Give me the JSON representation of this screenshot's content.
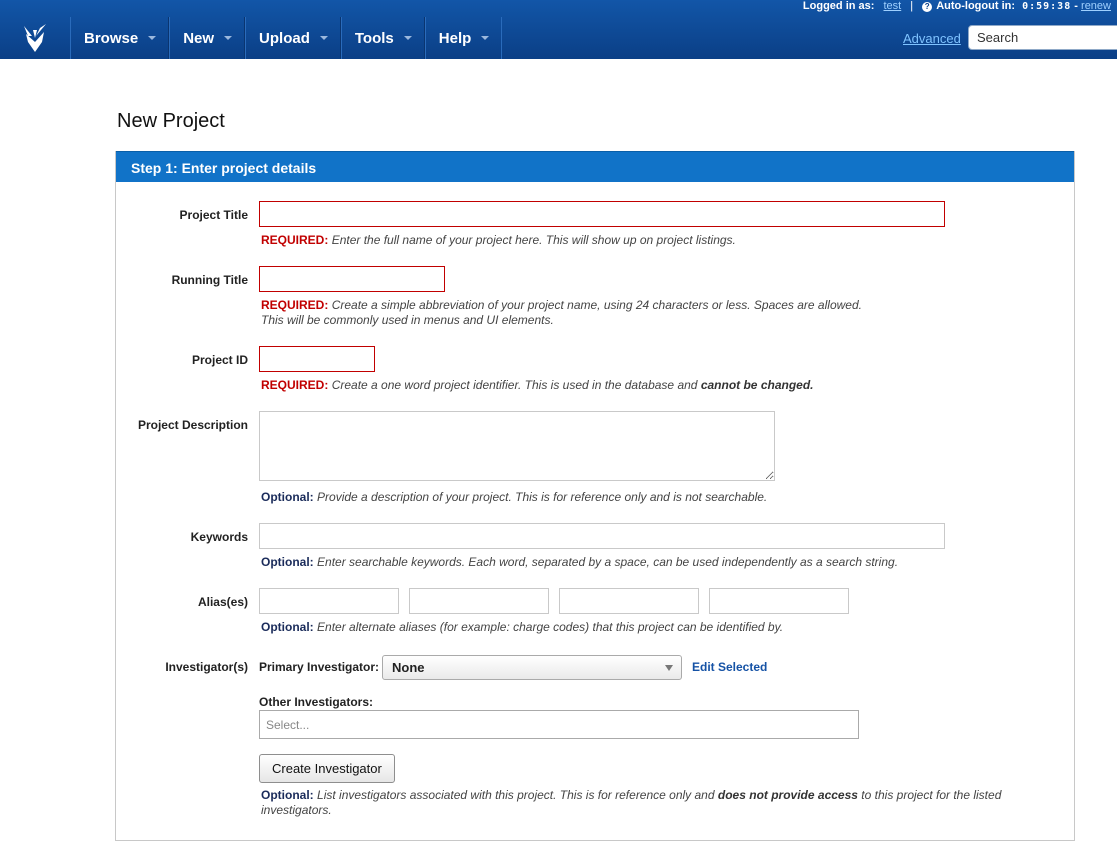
{
  "session": {
    "logged_in_label": "Logged in as:",
    "username": "test",
    "autologout_label": "Auto-logout in:",
    "time": "0:59:38",
    "renew": "renew"
  },
  "nav": {
    "items": [
      "Browse",
      "New",
      "Upload",
      "Tools",
      "Help"
    ],
    "advanced": "Advanced",
    "search_placeholder": "Search"
  },
  "page": {
    "title": "New Project",
    "step_header": "Step 1: Enter project details"
  },
  "form": {
    "project_title": {
      "label": "Project Title",
      "tag": "REQUIRED:",
      "hint": "Enter the full name of your project here. This will show up on project listings."
    },
    "running_title": {
      "label": "Running Title",
      "tag": "REQUIRED:",
      "hint": "Create a simple abbreviation of your project name, using 24 characters or less. Spaces are allowed.",
      "hint2": "This will be commonly used in menus and UI elements."
    },
    "project_id": {
      "label": "Project ID",
      "tag": "REQUIRED:",
      "hint": "Create a one word project identifier. This is used in the database and",
      "hint_bold": "cannot be changed."
    },
    "description": {
      "label": "Project Description",
      "tag": "Optional:",
      "hint": "Provide a description of your project. This is for reference only and is not searchable."
    },
    "keywords": {
      "label": "Keywords",
      "tag": "Optional:",
      "hint": "Enter searchable keywords. Each word, separated by a space, can be used independently as a search string."
    },
    "aliases": {
      "label": "Alias(es)",
      "tag": "Optional:",
      "hint": "Enter alternate aliases (for example: charge codes) that this project can be identified by."
    },
    "investigators": {
      "label": "Investigator(s)",
      "primary_label": "Primary Investigator:",
      "primary_value": "None",
      "edit_selected": "Edit Selected",
      "other_label": "Other Investigators:",
      "other_placeholder": "Select...",
      "create_button": "Create Investigator",
      "tag": "Optional:",
      "hint_a": "List investigators associated with this project. This is for reference only and",
      "hint_bold": "does not provide access",
      "hint_b": "to this project for the listed",
      "hint_c": "investigators."
    }
  }
}
